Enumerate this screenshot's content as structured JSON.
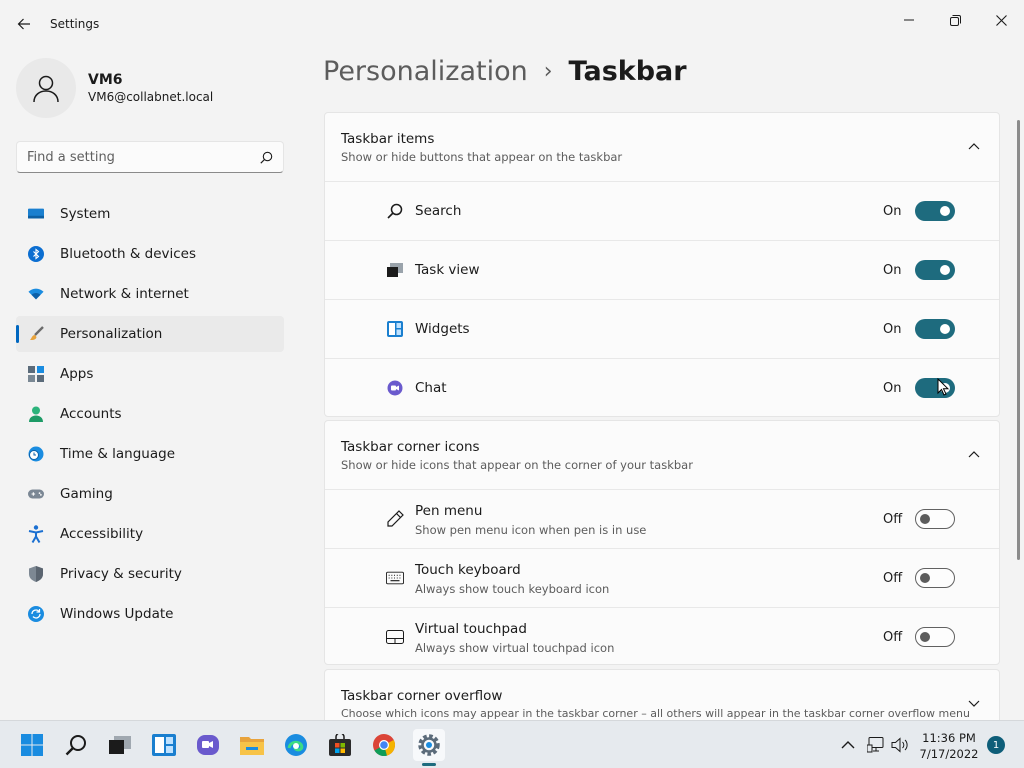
{
  "window": {
    "title": "Settings"
  },
  "profile": {
    "name": "VM6",
    "email": "VM6@collabnet.local"
  },
  "search": {
    "placeholder": "Find a setting"
  },
  "nav": {
    "items": [
      {
        "label": "System",
        "icon": "monitor-icon"
      },
      {
        "label": "Bluetooth & devices",
        "icon": "bluetooth-icon"
      },
      {
        "label": "Network & internet",
        "icon": "wifi-icon"
      },
      {
        "label": "Personalization",
        "icon": "brush-icon",
        "selected": true
      },
      {
        "label": "Apps",
        "icon": "apps-icon"
      },
      {
        "label": "Accounts",
        "icon": "person-icon"
      },
      {
        "label": "Time & language",
        "icon": "clock-globe-icon"
      },
      {
        "label": "Gaming",
        "icon": "gamepad-icon"
      },
      {
        "label": "Accessibility",
        "icon": "accessibility-icon"
      },
      {
        "label": "Privacy & security",
        "icon": "shield-icon"
      },
      {
        "label": "Windows Update",
        "icon": "update-icon"
      }
    ]
  },
  "breadcrumb": {
    "parent": "Personalization",
    "separator": "›",
    "current": "Taskbar"
  },
  "sections": {
    "taskbar_items": {
      "title": "Taskbar items",
      "subtitle": "Show or hide buttons that appear on the taskbar",
      "expanded": true,
      "rows": [
        {
          "label": "Search",
          "state": "On",
          "on": true,
          "icon": "search-icon"
        },
        {
          "label": "Task view",
          "state": "On",
          "on": true,
          "icon": "task-view-icon"
        },
        {
          "label": "Widgets",
          "state": "On",
          "on": true,
          "icon": "widgets-icon"
        },
        {
          "label": "Chat",
          "state": "On",
          "on": true,
          "icon": "chat-icon"
        }
      ]
    },
    "corner_icons": {
      "title": "Taskbar corner icons",
      "subtitle": "Show or hide icons that appear on the corner of your taskbar",
      "expanded": true,
      "rows": [
        {
          "label": "Pen menu",
          "sub": "Show pen menu icon when pen is in use",
          "state": "Off",
          "on": false,
          "icon": "pen-icon"
        },
        {
          "label": "Touch keyboard",
          "sub": "Always show touch keyboard icon",
          "state": "Off",
          "on": false,
          "icon": "keyboard-icon"
        },
        {
          "label": "Virtual touchpad",
          "sub": "Always show virtual touchpad icon",
          "state": "Off",
          "on": false,
          "icon": "touchpad-icon"
        }
      ]
    },
    "corner_overflow": {
      "title": "Taskbar corner overflow",
      "subtitle": "Choose which icons may appear in the taskbar corner – all others will appear in the taskbar corner overflow menu",
      "expanded": false
    }
  },
  "taskbar": {
    "apps": [
      "start-icon",
      "search-icon",
      "task-view-icon",
      "widgets-icon",
      "chat-icon",
      "file-explorer-icon",
      "edge-icon",
      "store-icon",
      "chrome-icon",
      "settings-icon"
    ],
    "active_app": "settings-icon",
    "clock": {
      "time": "11:36 PM",
      "date": "7/17/2022"
    },
    "notification_count": "1"
  },
  "colors": {
    "accent": "#0067c0",
    "toggle_on": "#1e6b7e"
  }
}
